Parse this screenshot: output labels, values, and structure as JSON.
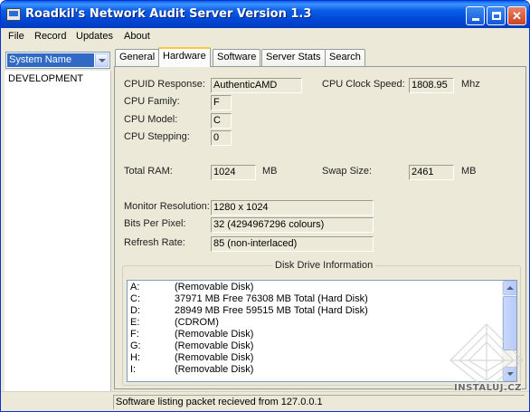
{
  "window": {
    "title": "Roadkil's Network Audit Server Version 1.3"
  },
  "menu": [
    "File",
    "Record",
    "Updates",
    "About"
  ],
  "sidebar": {
    "selected_field": "System Name",
    "items": [
      "DEVELOPMENT"
    ]
  },
  "tabs": [
    "General",
    "Hardware",
    "Software",
    "Server Stats",
    "Search"
  ],
  "active_tab": "Hardware",
  "hardware": {
    "cpuid_label": "CPUID Response:",
    "cpuid_value": "AuthenticAMD",
    "cpu_family_label": "CPU Family:",
    "cpu_family_value": "F",
    "cpu_model_label": "CPU Model:",
    "cpu_model_value": "C",
    "cpu_stepping_label": "CPU Stepping:",
    "cpu_stepping_value": "0",
    "clock_label": "CPU Clock Speed:",
    "clock_value": "1808.95",
    "clock_unit": "Mhz",
    "ram_label": "Total RAM:",
    "ram_value": "1024",
    "ram_unit": "MB",
    "swap_label": "Swap Size:",
    "swap_value": "2461",
    "swap_unit": "MB",
    "monitor_label": "Monitor Resolution:",
    "monitor_value": "1280 x 1024",
    "bpp_label": "Bits Per Pixel:",
    "bpp_value": "32 (4294967296 colours)",
    "refresh_label": "Refresh Rate:",
    "refresh_value": "85 (non-interlaced)"
  },
  "disks": {
    "title": "Disk Drive Information",
    "rows": [
      {
        "drive": "A:",
        "info": "(Removable Disk)"
      },
      {
        "drive": "C:",
        "info": "37971 MB Free 76308 MB Total (Hard Disk)"
      },
      {
        "drive": "D:",
        "info": "28949 MB Free 59515 MB Total (Hard Disk)"
      },
      {
        "drive": "E:",
        "info": "(CDROM)"
      },
      {
        "drive": "F:",
        "info": "(Removable Disk)"
      },
      {
        "drive": "G:",
        "info": "(Removable Disk)"
      },
      {
        "drive": "H:",
        "info": "(Removable Disk)"
      },
      {
        "drive": "I:",
        "info": "(Removable Disk)"
      }
    ]
  },
  "status": "Software listing packet recieved from 127.0.0.1",
  "watermark": "INSTALUJ.CZ"
}
